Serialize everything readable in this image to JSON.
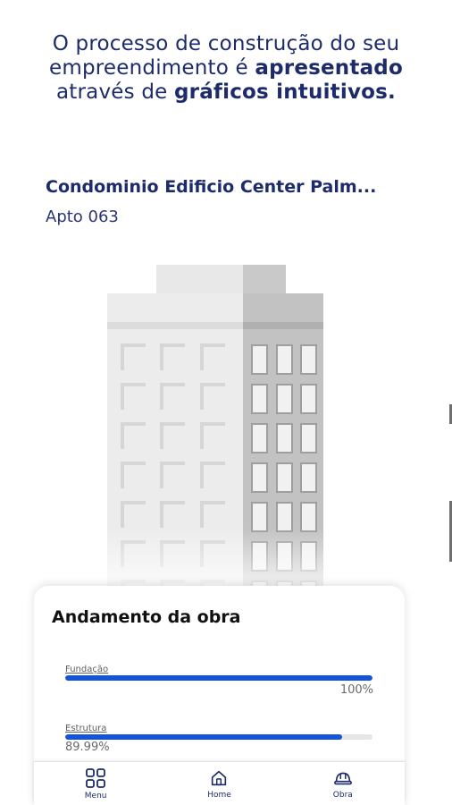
{
  "promo": {
    "line1": "O processo de construção do seu",
    "line2_regular": "empreendimento é ",
    "line2_bold": "apresentado",
    "line3_regular": "através de ",
    "line3_bold": "gráficos intuitivos."
  },
  "property": {
    "building_name": "Condominio Edificio Center Palm...",
    "unit": "Apto 063"
  },
  "progress_card": {
    "title": "Andamento da obra",
    "items": [
      {
        "label": "Fundação",
        "value_text": "100%",
        "fraction": 1.0
      },
      {
        "label": "Estrutura",
        "value_text": "89.99%",
        "fraction": 0.8999
      }
    ]
  },
  "tabbar": {
    "items": [
      {
        "label": "Menu",
        "icon": "grid-icon"
      },
      {
        "label": "Home",
        "icon": "home-icon"
      },
      {
        "label": "Obra",
        "icon": "hard-hat-icon"
      }
    ]
  },
  "colors": {
    "brand_navy": "#1d2b6b",
    "progress_blue": "#1553d9",
    "track_gray": "#e6e6e6"
  }
}
